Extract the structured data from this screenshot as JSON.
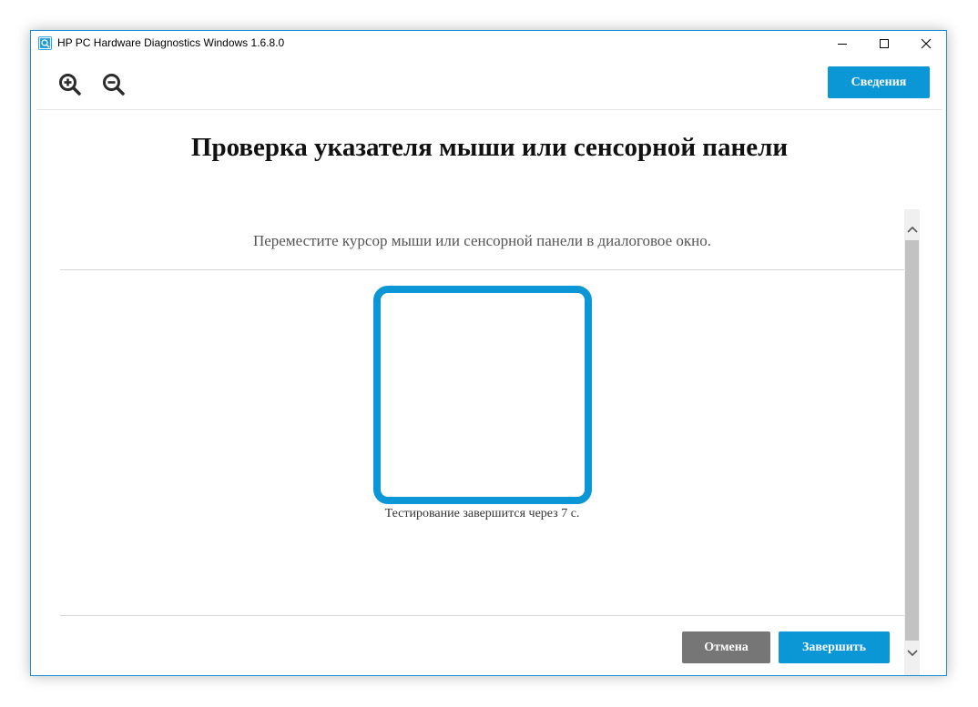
{
  "window": {
    "title": "HP PC Hardware Diagnostics Windows 1.6.8.0",
    "icons": {
      "app": "hp-diagnostics-icon",
      "minimize": "minimize-icon",
      "maximize": "maximize-icon",
      "close": "close-icon"
    }
  },
  "toolbar": {
    "zoom_in_icon": "zoom-in-icon",
    "zoom_out_icon": "zoom-out-icon",
    "info_label": "Сведения"
  },
  "page": {
    "title": "Проверка указателя мыши или сенсорной панели",
    "instruction": "Переместите курсор мыши или сенсорной панели в диалоговое окно.",
    "countdown": "Тестирование завершится через 7 с."
  },
  "actions": {
    "cancel_label": "Отмена",
    "finish_label": "Завершить"
  },
  "colors": {
    "accent": "#0b96d6",
    "cancel": "#767676",
    "window_border": "#1a8fd8"
  }
}
